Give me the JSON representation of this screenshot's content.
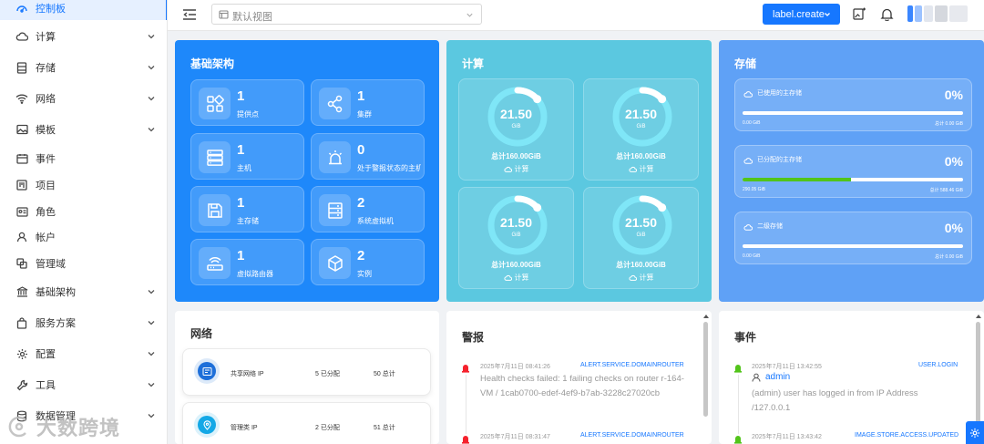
{
  "sidebar": {
    "items": [
      {
        "label": "控制板",
        "icon": "dashboard-icon",
        "active": true,
        "expandable": false
      },
      {
        "label": "计算",
        "icon": "cloud-icon",
        "expandable": true
      },
      {
        "label": "存储",
        "icon": "storage-icon",
        "expandable": true
      },
      {
        "label": "网络",
        "icon": "wifi-icon",
        "expandable": true
      },
      {
        "label": "模板",
        "icon": "image-icon",
        "expandable": true
      },
      {
        "label": "事件",
        "icon": "calendar-icon",
        "expandable": false
      },
      {
        "label": "项目",
        "icon": "project-icon",
        "expandable": false
      },
      {
        "label": "角色",
        "icon": "id-card-icon",
        "expandable": false
      },
      {
        "label": "帐户",
        "icon": "user-icon",
        "expandable": false
      },
      {
        "label": "管理域",
        "icon": "domain-icon",
        "expandable": false
      },
      {
        "label": "基础架构",
        "icon": "bank-icon",
        "expandable": true
      },
      {
        "label": "服务方案",
        "icon": "shopping-bag-icon",
        "expandable": true
      },
      {
        "label": "配置",
        "icon": "settings-icon",
        "expandable": true
      },
      {
        "label": "工具",
        "icon": "tool-icon",
        "expandable": true
      },
      {
        "label": "数据管理",
        "icon": "database-icon",
        "expandable": true
      }
    ],
    "watermark": "大数跨境"
  },
  "header": {
    "view_placeholder": "默认视图",
    "create_label": "label.create",
    "icons": [
      "menu-fold-icon",
      "add-image-icon",
      "bell-icon"
    ]
  },
  "colors": {
    "accent": "#1677ff",
    "infra_bg": "#1e88fa",
    "compute_bg": "#5bc8e0",
    "storage_bg": "#5fa1f6",
    "progress_green": "#52c41a",
    "alert_red": "#f5222d",
    "event_green": "#52c41a"
  },
  "infrastructure": {
    "title": "基础架构",
    "tiles": [
      {
        "value": "1",
        "label": "提供点",
        "icon": "apps-icon"
      },
      {
        "value": "1",
        "label": "集群",
        "icon": "cluster-icon"
      },
      {
        "value": "1",
        "label": "主机",
        "icon": "server-icon"
      },
      {
        "value": "0",
        "label": "处于警报状态的主机",
        "icon": "alarm-icon"
      },
      {
        "value": "1",
        "label": "主存储",
        "icon": "save-icon"
      },
      {
        "value": "2",
        "label": "系统虚拟机",
        "icon": "cabinet-icon"
      },
      {
        "value": "1",
        "label": "虚拟路由器",
        "icon": "router-icon"
      },
      {
        "value": "2",
        "label": "实例",
        "icon": "cube-icon"
      }
    ]
  },
  "compute": {
    "title": "计算",
    "tiles": [
      {
        "value": "21.50",
        "unit": "GiB",
        "total": "总计160.00GiB",
        "type": "计算",
        "ratio": 0.134
      },
      {
        "value": "21.50",
        "unit": "GiB",
        "total": "总计160.00GiB",
        "type": "计算",
        "ratio": 0.134
      },
      {
        "value": "21.50",
        "unit": "GiB",
        "total": "总计160.00GiB",
        "type": "计算",
        "ratio": 0.134
      },
      {
        "value": "21.50",
        "unit": "GiB",
        "total": "总计160.00GiB",
        "type": "计算",
        "ratio": 0.134
      }
    ]
  },
  "storage": {
    "title": "存储",
    "tiles": [
      {
        "name": "已使用的主存储",
        "percent": "0%",
        "used": "0.00 GiB",
        "total": "总计 0.00 GiB",
        "fill": 0
      },
      {
        "name": "已分配的主存储",
        "percent": "0%",
        "used": "290.05 GiB",
        "total": "总计 588.46 GiB",
        "fill": 0.493
      },
      {
        "name": "二级存储",
        "percent": "0%",
        "used": "0.00 GiB",
        "total": "总计 0.00 GiB",
        "fill": 0
      }
    ]
  },
  "network": {
    "title": "网络",
    "rows": [
      {
        "name": "共享网络 IP",
        "allocated": "5 已分配",
        "total": "50 总计",
        "icon": "network-card-icon",
        "color": "#1e6fd9"
      },
      {
        "name": "管理类 IP",
        "allocated": "2 已分配",
        "total": "51 总计",
        "icon": "location-icon",
        "color": "#13a8e6"
      }
    ]
  },
  "alerts": {
    "title": "警报",
    "items": [
      {
        "time": "2025年7月11日 08:41:26",
        "type": "ALERT.SERVICE.DOMAINROUTER",
        "message": "Health checks failed: 1 failing checks on router r-164-VM / 1cab0700-edef-4ef9-b7ab-3228c27020cb"
      },
      {
        "time": "2025年7月11日 08:31:47",
        "type": "ALERT.SERVICE.DOMAINROUTER",
        "message": ""
      }
    ]
  },
  "events": {
    "title": "事件",
    "items": [
      {
        "time": "2025年7月11日 13:42:55",
        "type": "USER.LOGIN",
        "user": "admin",
        "message": "(admin) user has logged in from IP Address /127.0.0.1"
      },
      {
        "time": "2025年7月11日 13:43:42",
        "type": "IMAGE.STORE.ACCESS.UPDATED",
        "user": "",
        "message": ""
      }
    ]
  }
}
